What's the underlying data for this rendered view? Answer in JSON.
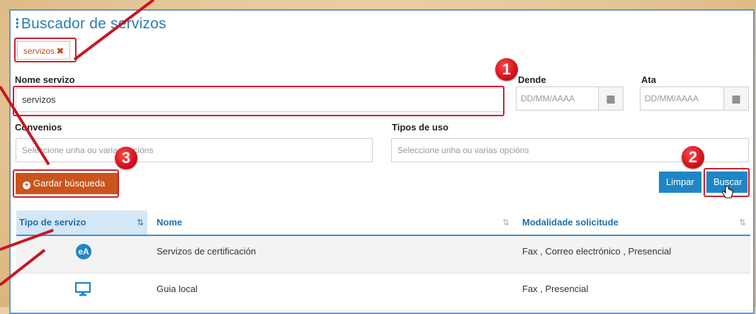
{
  "title": "Buscador de servizos",
  "filter_tag": {
    "label": "servizos",
    "remove_glyph": "✖"
  },
  "form": {
    "nome_label": "Nome servizo",
    "nome_value": "servizos",
    "dende_label": "Dende",
    "ata_label": "Ata",
    "date_placeholder": "DD/MM/AAAA",
    "convenios_label": "Convenios",
    "convenios_placeholder": "Seleccione unha ou varias opcións",
    "tipos_label": "Tipos de uso",
    "tipos_placeholder": "Seleccione unha ou varias opcións"
  },
  "buttons": {
    "save": "Gardar búsqueda",
    "clear": "Limpar",
    "search": "Buscar"
  },
  "badges": [
    "1",
    "2",
    "3"
  ],
  "table": {
    "headers": [
      "Tipo de servizo",
      "Nome",
      "Modalidade solicitude"
    ],
    "rows": [
      {
        "icon": "eA-icon",
        "nome": "Servizos de certificación",
        "modalidade": "Fax , Correo electrónico , Presencial"
      },
      {
        "icon": "monitor-icon",
        "nome": "Guia local",
        "modalidade": "Fax , Presencial"
      }
    ]
  },
  "colors": {
    "accent_blue": "#1f86c5",
    "save_orange": "#c9551c",
    "annotation_red": "#cc1f2a",
    "title_blue": "#2b7cb6"
  }
}
